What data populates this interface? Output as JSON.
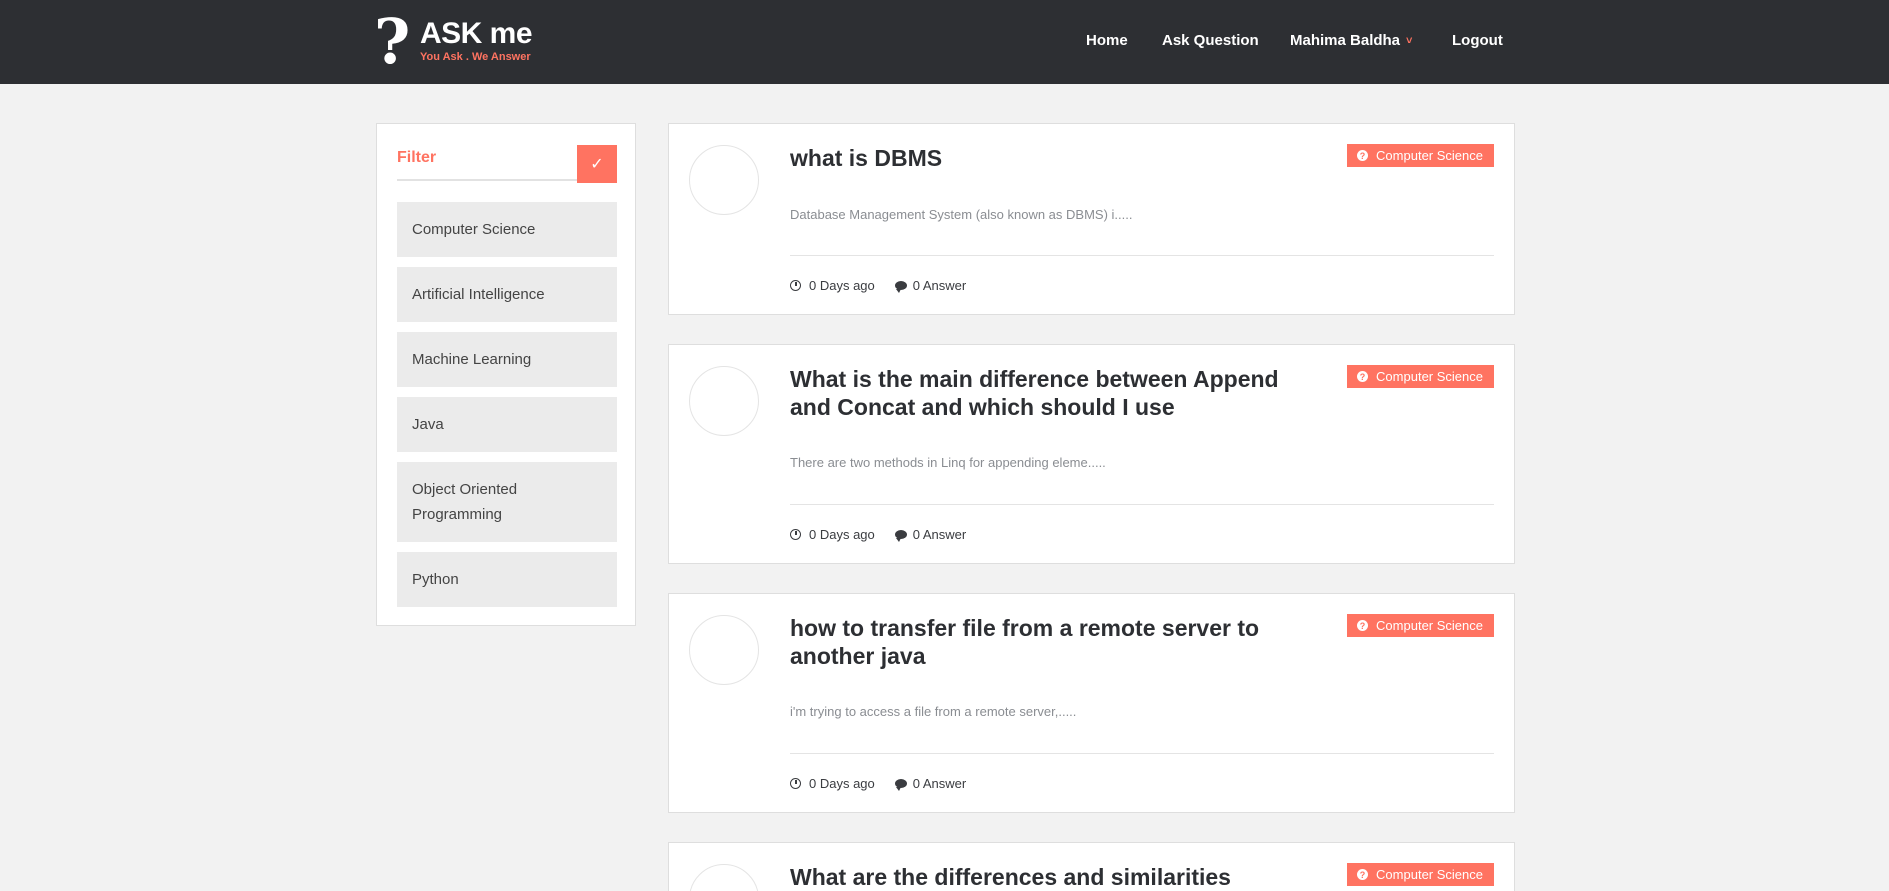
{
  "brand": {
    "logo_glyph": "?",
    "title": "ASK me",
    "tagline": "You Ask . We Answer",
    "accent_color": "#ff7361",
    "header_color": "#2d2f33"
  },
  "nav": {
    "home": "Home",
    "ask": "Ask Question",
    "user": "Mahima Baldha",
    "user_chevron": "˅",
    "logout": "Logout"
  },
  "filter": {
    "label": "Filter",
    "apply_glyph": "✓",
    "categories": [
      "Computer Science",
      "Artificial Intelligence",
      "Machine Learning",
      "Java",
      "Object Oriented Programming",
      "Python"
    ]
  },
  "questions": [
    {
      "title": "what is DBMS",
      "category": "Computer Science",
      "excerpt": "Database Management System (also known as DBMS) i.....",
      "time": "0 Days ago",
      "answers": "0 Answer"
    },
    {
      "title": "What is the main difference between Append and Concat and which should I use",
      "category": "Computer Science",
      "excerpt": "There are two methods in Linq for appending eleme.....",
      "time": "0 Days ago",
      "answers": "0 Answer"
    },
    {
      "title": "how to transfer file from a remote server to another java",
      "category": "Computer Science",
      "excerpt": "i'm trying to access a file from a remote server,.....",
      "time": "0 Days ago",
      "answers": "0 Answer"
    },
    {
      "title": "What are the differences and similarities",
      "category": "Computer Science"
    }
  ]
}
